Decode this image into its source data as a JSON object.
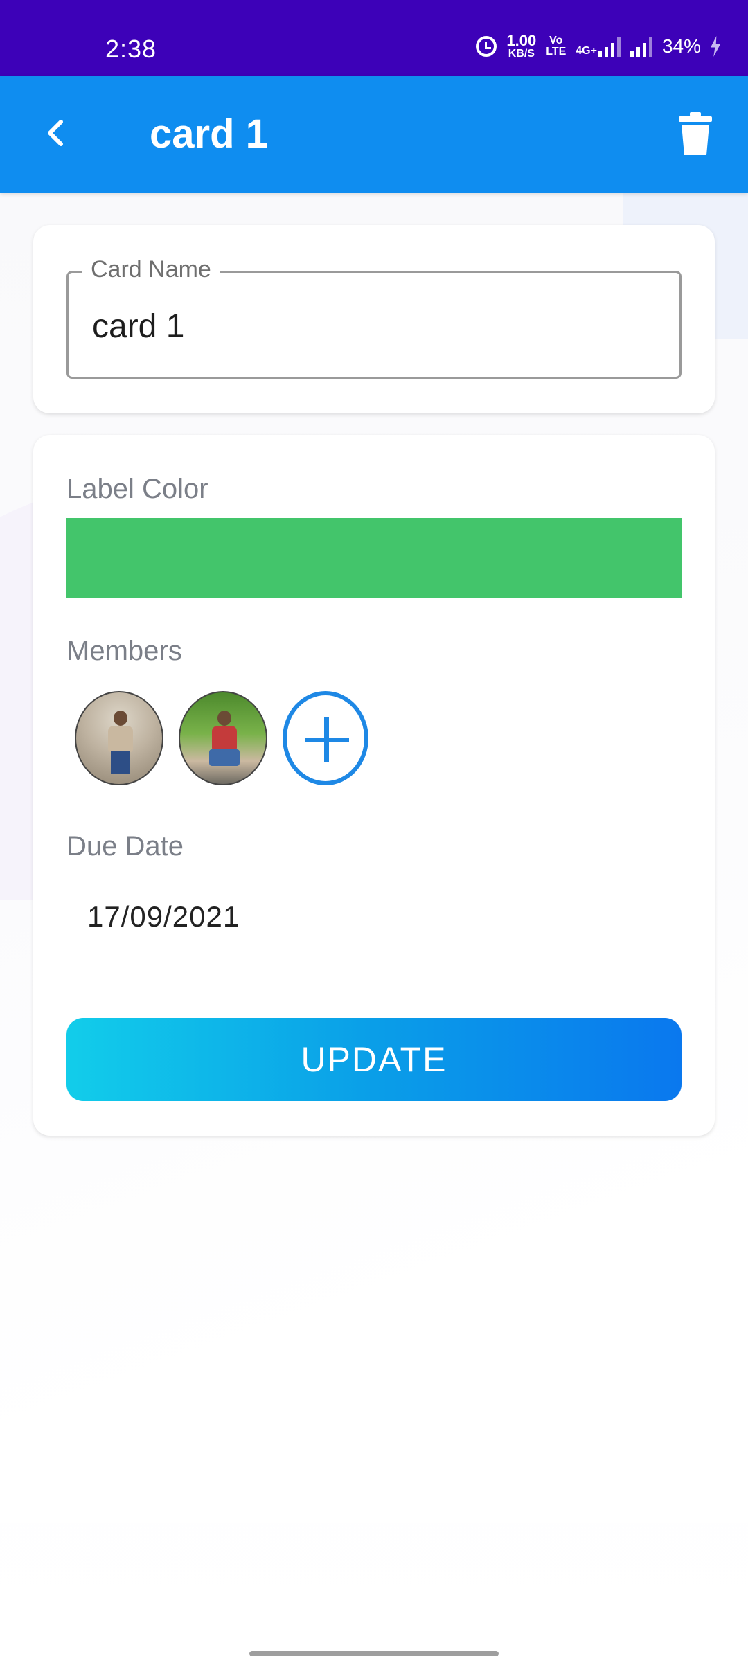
{
  "status_bar": {
    "time": "2:38",
    "net_speed_top": "1.00",
    "net_speed_bottom": "KB/S",
    "volte_top": "Vo",
    "volte_bottom": "LTE",
    "network_type": "4G+",
    "battery": "34%"
  },
  "app_bar": {
    "title": "card 1",
    "back_icon": "chevron-left-icon",
    "delete_icon": "trash-icon",
    "color": "#0f8df0"
  },
  "card_name_field": {
    "label": "Card Name",
    "value": "card 1"
  },
  "details": {
    "label_color_title": "Label Color",
    "label_color": "#43c56b",
    "members_title": "Members",
    "members": [
      {
        "name": "member-1"
      },
      {
        "name": "member-2"
      }
    ],
    "add_member_icon": "plus-circle-icon",
    "due_date_title": "Due Date",
    "due_date": "17/09/2021",
    "update_label": "UPDATE"
  },
  "colors": {
    "status_bar": "#3d01b8",
    "accent": "#1e88e5"
  }
}
